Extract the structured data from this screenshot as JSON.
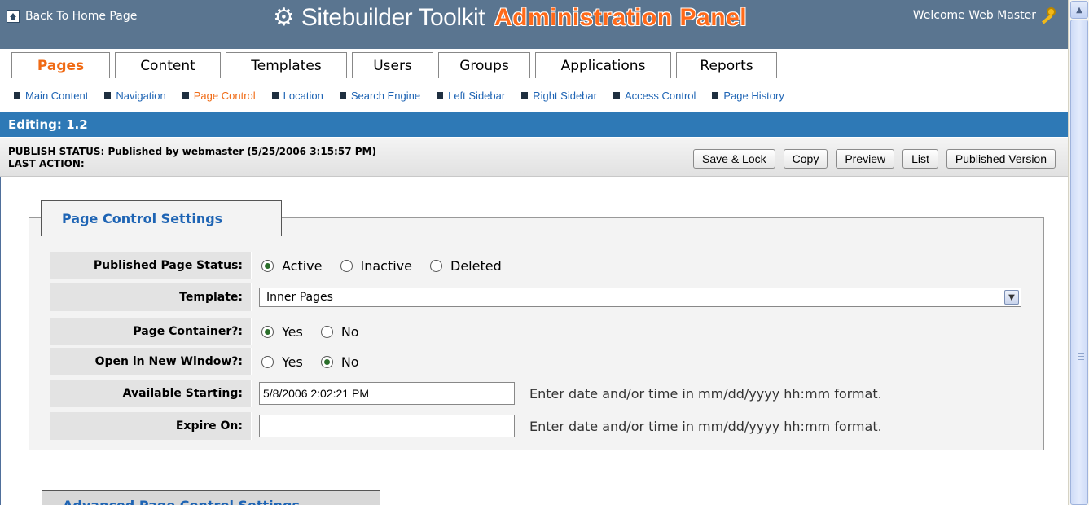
{
  "header": {
    "home_link": "Back To Home Page",
    "title": "Sitebuilder Toolkit",
    "subtitle": "Administration Panel",
    "welcome": "Welcome Web Master",
    "icons": [
      "home-icon",
      "gear-icon",
      "key-icon"
    ],
    "colors": {
      "header_bg": "#5a7590",
      "accent": "#f06a14",
      "link": "#1e64b4",
      "editing_bar": "#2e79b6"
    }
  },
  "tabs": [
    {
      "label": "Pages",
      "active": true
    },
    {
      "label": "Content",
      "active": false
    },
    {
      "label": "Templates",
      "active": false
    },
    {
      "label": "Users",
      "active": false
    },
    {
      "label": "Groups",
      "active": false
    },
    {
      "label": "Applications",
      "active": false
    },
    {
      "label": "Reports",
      "active": false
    }
  ],
  "subnav": [
    {
      "label": "Main Content",
      "active": false
    },
    {
      "label": "Navigation",
      "active": false
    },
    {
      "label": "Page Control",
      "active": true
    },
    {
      "label": "Location",
      "active": false
    },
    {
      "label": "Search Engine",
      "active": false
    },
    {
      "label": "Left Sidebar",
      "active": false
    },
    {
      "label": "Right Sidebar",
      "active": false
    },
    {
      "label": "Access Control",
      "active": false
    },
    {
      "label": "Page History",
      "active": false
    }
  ],
  "editing": {
    "label": "Editing: 1.2"
  },
  "status": {
    "publish": "PUBLISH STATUS: Published by webmaster (5/25/2006 3:15:57 PM)",
    "last_action": "LAST ACTION:"
  },
  "actions": {
    "save_lock": "Save & Lock",
    "copy": "Copy",
    "preview": "Preview",
    "list": "List",
    "published_version": "Published Version"
  },
  "settings": {
    "title": "Page Control Settings",
    "published_status": {
      "label": "Published Page Status:",
      "options": [
        "Active",
        "Inactive",
        "Deleted"
      ],
      "selected": "Active"
    },
    "template": {
      "label": "Template:",
      "value": "Inner Pages"
    },
    "page_container": {
      "label": "Page Container?:",
      "options": [
        "Yes",
        "No"
      ],
      "selected": "Yes"
    },
    "new_window": {
      "label": "Open in New Window?:",
      "options": [
        "Yes",
        "No"
      ],
      "selected": "No"
    },
    "available_starting": {
      "label": "Available Starting:",
      "value": "5/8/2006 2:02:21 PM",
      "hint": "Enter date and/or time in mm/dd/yyyy hh:mm format."
    },
    "expire_on": {
      "label": "Expire On:",
      "value": "",
      "hint": "Enter date and/or time in mm/dd/yyyy hh:mm format."
    }
  },
  "advanced": {
    "title": "Advanced Page Control Settings"
  }
}
